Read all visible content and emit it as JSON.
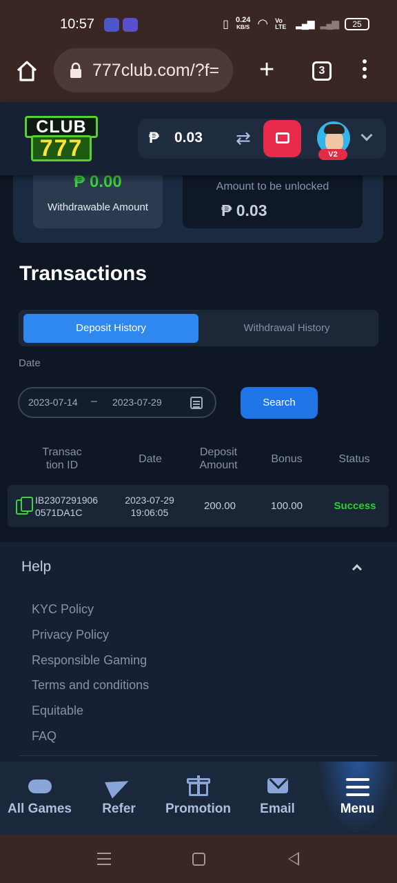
{
  "status_bar": {
    "time": "10:57",
    "network_speed_value": "0.24",
    "network_speed_unit": "KB/S",
    "volte": "Vo LTE",
    "battery": "25"
  },
  "browser": {
    "url": "777club.com/?f=",
    "tab_count": "3"
  },
  "header": {
    "logo_top": "CLUB",
    "logo_bottom": "777",
    "currency_symbol": "₱",
    "balance": "0.03",
    "vip_level": "V2"
  },
  "summary": {
    "withdrawable_amount": "₱ 0.00",
    "withdrawable_label": "Withdrawable Amount",
    "unlock_label": "Amount to be unlocked",
    "unlock_amount": "₱ 0.03"
  },
  "transactions": {
    "title": "Transactions",
    "tabs": [
      {
        "label": "Deposit History",
        "active": true
      },
      {
        "label": "Withdrawal History",
        "active": false
      }
    ],
    "date_label": "Date",
    "date_start": "2023-07-14",
    "date_separator": "–",
    "date_end": "2023-07-29",
    "search_label": "Search",
    "columns": [
      "Transac tion ID",
      "Date",
      "Deposit Amount",
      "Bonus",
      "Status"
    ],
    "rows": [
      {
        "id_line1": "IB2307291906",
        "id_line2": "0571DA1C",
        "date_line1": "2023-07-29",
        "date_line2": "19:06:05",
        "deposit_amount": "200.00",
        "bonus": "100.00",
        "status": "Success"
      }
    ]
  },
  "help": {
    "title": "Help",
    "links": [
      "KYC Policy",
      "Privacy Policy",
      "Responsible Gaming",
      "Terms and conditions",
      "Equitable",
      "FAQ"
    ]
  },
  "bottom_nav": {
    "items": [
      {
        "label": "All Games",
        "icon": "gamepad-icon"
      },
      {
        "label": "Refer",
        "icon": "paper-plane-icon"
      },
      {
        "label": "Promotion",
        "icon": "gift-icon"
      },
      {
        "label": "Email",
        "icon": "mail-icon"
      },
      {
        "label": "Menu",
        "icon": "menu-icon",
        "active": true
      }
    ]
  },
  "colors": {
    "accent_blue": "#2f87f0",
    "success_green": "#2ed12e",
    "wallet_red": "#ea2a4a",
    "background": "#0f1724"
  }
}
